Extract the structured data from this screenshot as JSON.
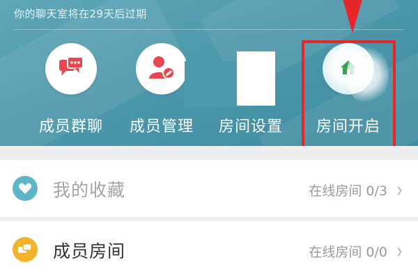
{
  "header": {
    "expiry_notice": "你的聊天室将在29天后过期",
    "actions": [
      {
        "label": "成员群聊",
        "icon": "chat-bubbles-icon"
      },
      {
        "label": "成员管理",
        "icon": "user-settings-icon"
      },
      {
        "label": "房间设置",
        "icon": "settings-icon"
      },
      {
        "label": "房间开启",
        "icon": "house-icon"
      }
    ]
  },
  "list": {
    "items": [
      {
        "title": "我的收藏",
        "status": "在线房间 0/3",
        "icon": "heart-icon"
      },
      {
        "title": "成员房间",
        "status": "在线房间 0/0",
        "icon": "chat-bubbles-icon"
      }
    ]
  },
  "colors": {
    "header_teal": "#4d98ab",
    "accent_red": "#e5262b",
    "icon_red": "#e8474f",
    "icon_green": "#3aa04d",
    "heart_teal": "#5cb6c8",
    "bubbles_yellow": "#f2b32b"
  }
}
